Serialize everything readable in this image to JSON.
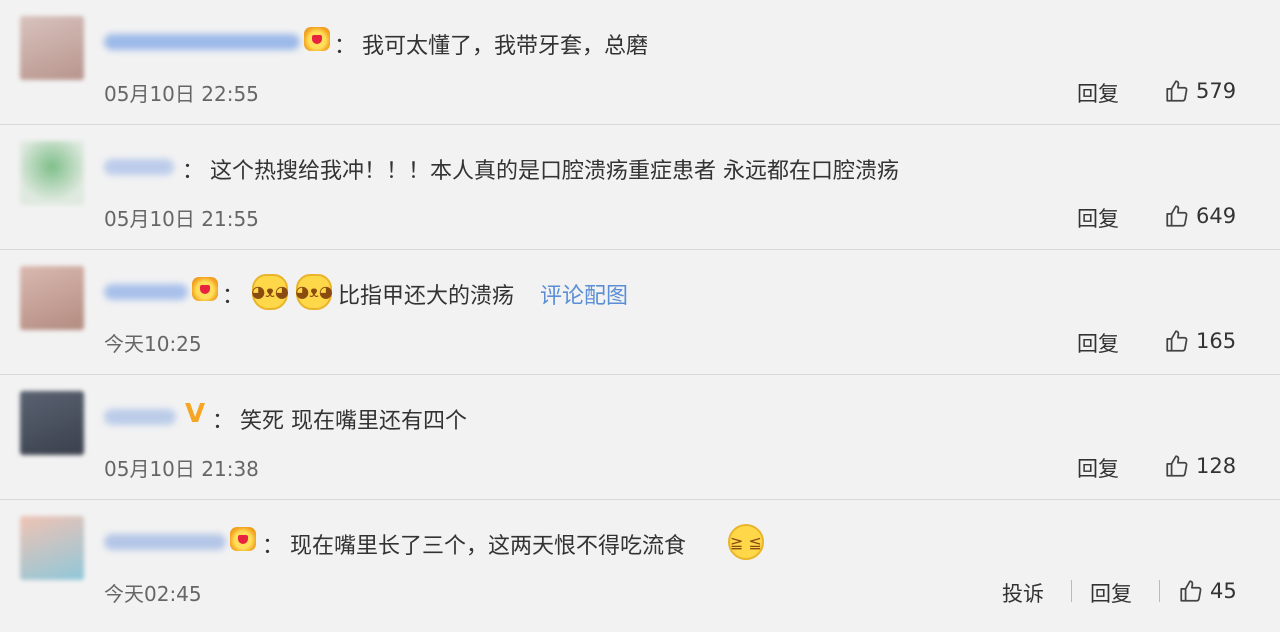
{
  "comments": [
    {
      "avatar_color": "#c9b2ad",
      "name_color": "#7fa6e6",
      "badge": "crown",
      "text": "我可太懂了，我带牙套，总磨",
      "time": "05月10日 22:55",
      "reply_label": "回复",
      "likes": "579"
    },
    {
      "avatar_color": "#9bbf9f",
      "name_color": "#a9bfe8",
      "badge": "none",
      "text": "这个热搜给我冲！！！本人真的是口腔溃疡重症患者 永远都在口腔溃疡",
      "time": "05月10日 21:55",
      "reply_label": "回复",
      "likes": "649"
    },
    {
      "avatar_color": "#c7a49b",
      "name_color": "#8fb0e8",
      "badge": "crown",
      "emojis": [
        "cat-face-emoji",
        "cat-face-emoji"
      ],
      "text": "比指甲还大的溃疡",
      "link_text": "评论配图",
      "time": "今天10:25",
      "reply_label": "回复",
      "likes": "165"
    },
    {
      "avatar_color": "#4e5666",
      "name_color": "#a8bfe6",
      "badge": "vip-v",
      "text": "笑死 现在嘴里还有四个",
      "time": "05月10日 21:38",
      "reply_label": "回复",
      "likes": "128"
    },
    {
      "avatar_color": "#e8b5a3",
      "name_color": "#9fb6e3",
      "badge": "crown",
      "text": "现在嘴里长了三个，这两天恨不得吃流食",
      "trailing_emoji": "crying-face-emoji",
      "time": "今天02:45",
      "report_label": "投诉",
      "reply_label": "回复",
      "likes": "45"
    }
  ],
  "colon": "："
}
